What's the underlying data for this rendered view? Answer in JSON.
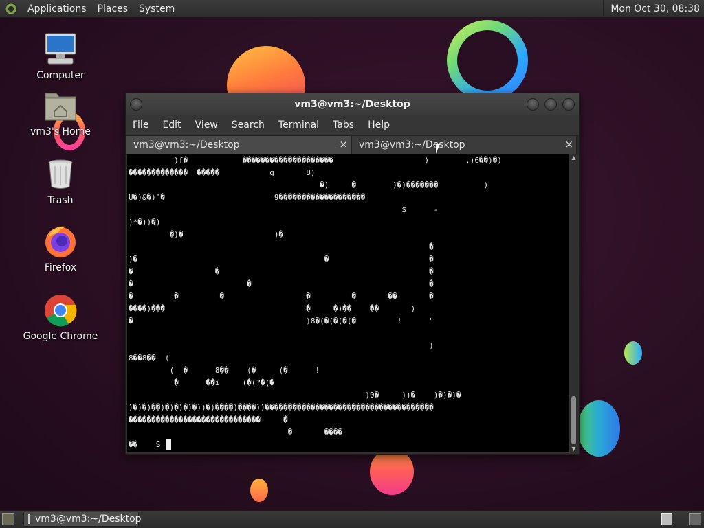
{
  "top_panel": {
    "menus": [
      "Applications",
      "Places",
      "System"
    ],
    "clock": "Mon Oct 30, 08:38"
  },
  "desktop_icons": [
    {
      "label": "Computer",
      "icon": "computer-icon"
    },
    {
      "label": "vm3's Home",
      "icon": "home-folder-icon"
    },
    {
      "label": "Trash",
      "icon": "trash-icon"
    },
    {
      "label": "Firefox",
      "icon": "firefox-icon"
    },
    {
      "label": "Google Chrome",
      "icon": "chrome-icon"
    }
  ],
  "terminal": {
    "title": "vm3@vm3:~/Desktop",
    "menu": [
      "File",
      "Edit",
      "View",
      "Search",
      "Terminal",
      "Tabs",
      "Help"
    ],
    "tabs": [
      {
        "label": "vm3@vm3:~/Desktop",
        "close": "×",
        "active": false
      },
      {
        "label": "vm3@vm3:~/Desktop",
        "close": "×",
        "active": true
      }
    ],
    "output": "          )f�            ��������������������                    )        .)6��)�)\n�������������  �����           g       8)\n                                          �)     �        )�)�������          )\nU�)&�)'�                        9�������������������\n                                                            $      -\n)*�))�)\n         �)�                    )�\n                                                                  �\n)�                                         �                      �\n�                  �                                              �\n�                         �                                       �\n�         �         �                  �         �       ��       �\n����)���                               �     �)��    ��       )\n�                                      )8�(�(�(�(�         !      \"\n\n                                                                  )\n8��8��  (\n         (  �      8��    (�     (�      !\n          �      ��i     (�(?�(�\n                                                    )0�     ))�    )�)�)�\n)�)�)��)�)�)�)�))�)����)����))�������������������������������������\n�����������������������������     �\n                                   �       ����\n��    S",
    "scroll_up": "▲",
    "scroll_down": "▼"
  },
  "taskbar": {
    "window_button": "vm3@vm3:~/Desktop"
  }
}
